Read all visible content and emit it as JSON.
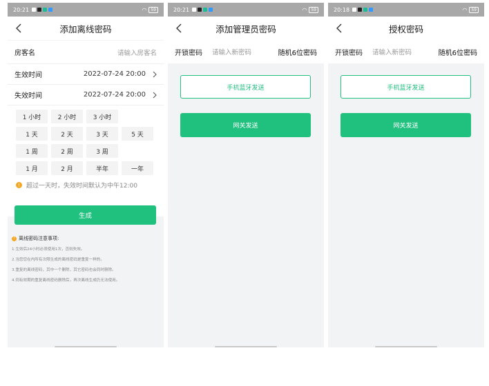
{
  "colors": {
    "accent": "#20c07f",
    "warning": "#f5a623",
    "statusbar": "#a8a8a8"
  },
  "screens": [
    {
      "status_time": "20:21",
      "title": "添加离线密码",
      "back_icon": "chevron-left-icon",
      "rows": [
        {
          "label": "房客名",
          "placeholder": "请输入房客名"
        },
        {
          "label": "生效时间",
          "value": "2022-07-24 20:00"
        },
        {
          "label": "失效时间",
          "value": "2022-07-24 20:00"
        }
      ],
      "chips": [
        [
          "1 小时",
          "2 小时",
          "3 小时"
        ],
        [
          "1 天",
          "2 天",
          "3 天",
          "5 天"
        ],
        [
          "1 周",
          "2 周",
          "3 周"
        ],
        [
          "1 月",
          "2 月",
          "半年",
          "一年"
        ]
      ],
      "hint": "超过一天时，失效时间默认为中午12:00",
      "generate_label": "生成",
      "notes_title": "离线密码注意事项:",
      "notes": [
        "1.生效后24小时必须使用1次，否则失效。",
        "2.当您您在内所有次限生成的离线密码是重复一样的。",
        "3.重复的离线密码，其中一个删除，其它密码也会同时删除。",
        "4.同有效期的重复离线密码删除后，再次离线生成仍无法使用。"
      ]
    },
    {
      "status_time": "20:21",
      "title": "添加管理员密码",
      "tab_label": "开锁密码",
      "tab_placeholder": "请输入新密码",
      "tab_random": "随机6位密码",
      "bluetooth_label": "手机蓝牙发送",
      "gateway_label": "网关发送"
    },
    {
      "status_time": "20:18",
      "title": "授权密码",
      "tab_label": "开锁密码",
      "tab_placeholder": "请输入新密码",
      "tab_random": "随机6位密码",
      "bluetooth_label": "手机蓝牙发送",
      "gateway_label": "网关发送"
    }
  ],
  "status_battery": "59"
}
